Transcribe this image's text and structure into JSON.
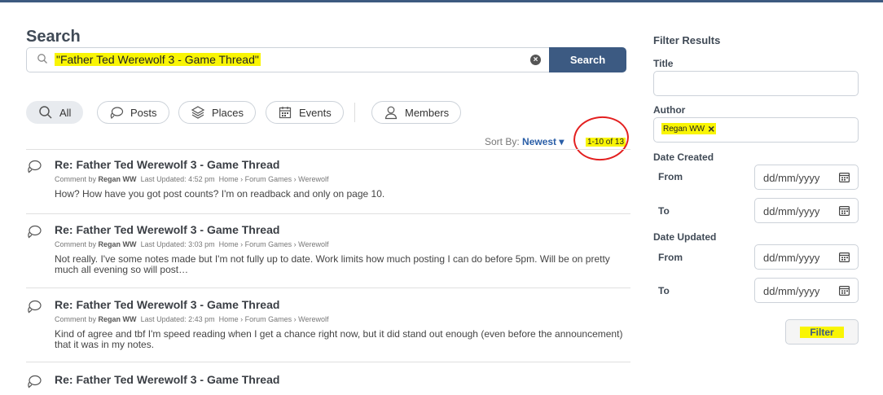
{
  "search": {
    "title": "Search",
    "query": "\"Father Ted Werewolf 3 - Game Thread\"",
    "button_label": "Search"
  },
  "tabs": [
    {
      "label": "All",
      "icon": "search-icon",
      "active": true
    },
    {
      "label": "Posts",
      "icon": "posts-icon",
      "active": false
    },
    {
      "label": "Places",
      "icon": "places-icon",
      "active": false
    },
    {
      "label": "Events",
      "icon": "calendar-icon",
      "active": false
    },
    {
      "label": "Members",
      "icon": "user-icon",
      "active": false
    }
  ],
  "sort": {
    "label": "Sort By:",
    "value": "Newest ▾"
  },
  "pager": "1-10 of 13",
  "results": [
    {
      "title": "Re: Father Ted Werewolf 3 - Game Thread",
      "type": "Comment by",
      "author": "Regan WW",
      "updated": "Last Updated: 4:52 pm",
      "breadcrumb": "Home › Forum Games › Werewolf",
      "excerpt": "How? How have you got post counts? I'm on readback and only on page 10."
    },
    {
      "title": "Re: Father Ted Werewolf 3 - Game Thread",
      "type": "Comment by",
      "author": "Regan WW",
      "updated": "Last Updated: 3:03 pm",
      "breadcrumb": "Home › Forum Games › Werewolf",
      "excerpt": "Not really. I've some notes made but I'm not fully up to date. Work limits how much posting I can do before 5pm. Will be on pretty much all evening so will post…"
    },
    {
      "title": "Re: Father Ted Werewolf 3 - Game Thread",
      "type": "Comment by",
      "author": "Regan WW",
      "updated": "Last Updated: 2:43 pm",
      "breadcrumb": "Home › Forum Games › Werewolf",
      "excerpt": "Kind of agree and tbf I'm speed reading when I get a chance right now, but it did stand out enough (even before the announcement) that it was in my notes."
    },
    {
      "title": "Re: Father Ted Werewolf 3 - Game Thread"
    }
  ],
  "sidebar": {
    "title": "Filter Results",
    "title_label": "Title",
    "title_value": "",
    "author_label": "Author",
    "author_token": "Regan WW",
    "date_created_label": "Date Created",
    "date_updated_label": "Date Updated",
    "from_label": "From",
    "to_label": "To",
    "date_placeholder": "dd/mm/yyyy",
    "filter_button": "Filter"
  },
  "colors": {
    "accent": "#3c5a82",
    "highlight": "#f9f504",
    "annotation": "#e31f1f"
  }
}
